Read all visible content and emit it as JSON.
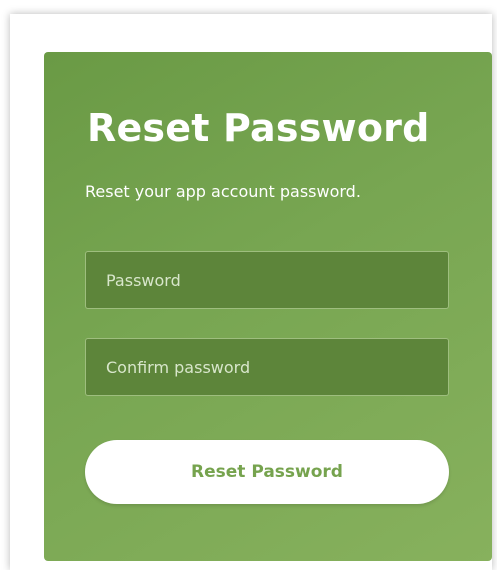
{
  "page": {
    "title": "Reset Password",
    "subtitle": "Reset your app account password."
  },
  "form": {
    "password_placeholder": "Password",
    "password_value": "",
    "confirm_placeholder": "Confirm password",
    "confirm_value": "",
    "submit_label": "Reset Password"
  },
  "colors": {
    "card_gradient_start": "#6a9a45",
    "card_gradient_end": "#87b15d",
    "field_background": "#5d853a",
    "button_text": "#76a34e",
    "button_background": "#ffffff"
  }
}
